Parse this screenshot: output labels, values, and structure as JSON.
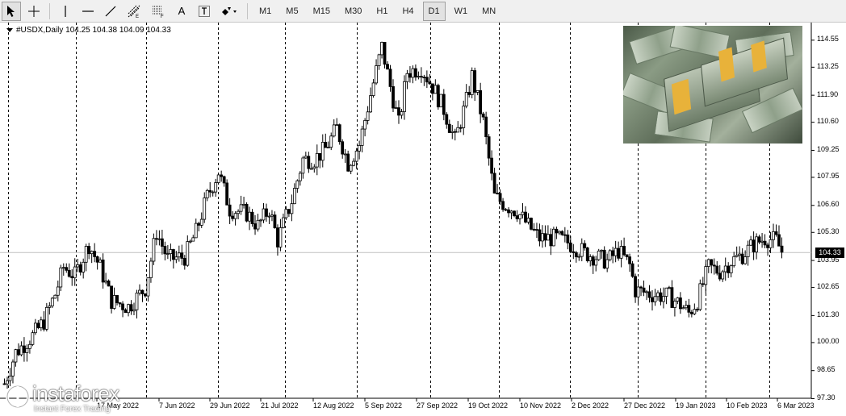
{
  "toolbar": {
    "tools": [
      {
        "name": "cursor",
        "icon": "arrow-cursor-icon"
      },
      {
        "name": "crosshair",
        "icon": "crosshair-icon"
      },
      {
        "name": "vertical-line",
        "icon": "vertical-line-icon"
      },
      {
        "name": "horizontal-line",
        "icon": "horizontal-line-icon"
      },
      {
        "name": "trend-line",
        "icon": "trend-line-icon"
      },
      {
        "name": "equidistant-channel",
        "icon": "channel-icon"
      },
      {
        "name": "fibonacci",
        "icon": "fibonacci-icon"
      },
      {
        "name": "text",
        "icon": "text-icon"
      },
      {
        "name": "text-label",
        "icon": "text-label-icon"
      },
      {
        "name": "shapes",
        "icon": "shapes-dropdown-icon"
      }
    ],
    "text_tool_glyph": "A",
    "timeframes": [
      "M1",
      "M5",
      "M15",
      "M30",
      "H1",
      "H4",
      "D1",
      "W1",
      "MN"
    ],
    "active_timeframe": "D1"
  },
  "chart": {
    "symbol_info": "#USDX,Daily  104.25 104.38 104.09 104.33",
    "price_levels": [
      "114.55",
      "113.25",
      "111.90",
      "110.60",
      "109.25",
      "107.95",
      "106.60",
      "105.30",
      "103.95",
      "102.65",
      "101.30",
      "100.00",
      "98.65",
      "97.30"
    ],
    "current_price": "104.33",
    "dates": [
      "17 May 2022",
      "7 Jun 2022",
      "29 Jun 2022",
      "21 Jul 2022",
      "12 Aug 2022",
      "5 Sep 2022",
      "27 Sep 2022",
      "19 Oct 2022",
      "10 Nov 2022",
      "2 Dec 2022",
      "27 Dec 2022",
      "19 Jan 2023",
      "10 Feb 2023",
      "6 Mar 2023"
    ],
    "colors": {
      "bull": "#ffffff",
      "bear": "#000000",
      "grid": "#000000",
      "price_line": "#c0c0c0"
    }
  },
  "logo": {
    "name": "instaforex",
    "tagline": "Instant Forex Trading"
  },
  "chart_data": {
    "type": "candlestick",
    "title": "#USDX,Daily",
    "ylim": [
      97.3,
      115.3
    ],
    "current": 104.33,
    "y_ticks": [
      114.55,
      113.25,
      111.9,
      110.6,
      109.25,
      107.95,
      106.6,
      105.3,
      103.95,
      102.65,
      101.3,
      100.0,
      98.65,
      97.3
    ],
    "anchors": [
      {
        "i": 0,
        "v": 98.0
      },
      {
        "i": 4,
        "v": 99.5
      },
      {
        "i": 10,
        "v": 100.3
      },
      {
        "i": 14,
        "v": 101.0
      },
      {
        "i": 18,
        "v": 102.3
      },
      {
        "i": 21,
        "v": 103.6
      },
      {
        "i": 25,
        "v": 103.2
      },
      {
        "i": 30,
        "v": 104.7
      },
      {
        "i": 34,
        "v": 103.6
      },
      {
        "i": 38,
        "v": 102.0
      },
      {
        "i": 44,
        "v": 101.7
      },
      {
        "i": 50,
        "v": 102.6
      },
      {
        "i": 54,
        "v": 105.3
      },
      {
        "i": 58,
        "v": 104.0
      },
      {
        "i": 64,
        "v": 104.1
      },
      {
        "i": 68,
        "v": 105.3
      },
      {
        "i": 72,
        "v": 107.0
      },
      {
        "i": 76,
        "v": 108.2
      },
      {
        "i": 80,
        "v": 106.4
      },
      {
        "i": 86,
        "v": 106.2
      },
      {
        "i": 90,
        "v": 105.6
      },
      {
        "i": 94,
        "v": 106.4
      },
      {
        "i": 97,
        "v": 104.9
      },
      {
        "i": 102,
        "v": 106.8
      },
      {
        "i": 106,
        "v": 108.8
      },
      {
        "i": 110,
        "v": 108.8
      },
      {
        "i": 114,
        "v": 109.3
      },
      {
        "i": 118,
        "v": 110.3
      },
      {
        "i": 122,
        "v": 108.6
      },
      {
        "i": 126,
        "v": 109.5
      },
      {
        "i": 130,
        "v": 111.9
      },
      {
        "i": 134,
        "v": 114.2
      },
      {
        "i": 137,
        "v": 112.3
      },
      {
        "i": 140,
        "v": 110.5
      },
      {
        "i": 143,
        "v": 113.0
      },
      {
        "i": 148,
        "v": 113.2
      },
      {
        "i": 152,
        "v": 112.3
      },
      {
        "i": 156,
        "v": 111.2
      },
      {
        "i": 160,
        "v": 109.7
      },
      {
        "i": 164,
        "v": 111.6
      },
      {
        "i": 166,
        "v": 112.8
      },
      {
        "i": 170,
        "v": 110.6
      },
      {
        "i": 174,
        "v": 107.0
      },
      {
        "i": 178,
        "v": 106.6
      },
      {
        "i": 182,
        "v": 106.3
      },
      {
        "i": 186,
        "v": 105.6
      },
      {
        "i": 190,
        "v": 105.0
      },
      {
        "i": 196,
        "v": 105.0
      },
      {
        "i": 200,
        "v": 104.8
      },
      {
        "i": 206,
        "v": 104.3
      },
      {
        "i": 210,
        "v": 104.1
      },
      {
        "i": 214,
        "v": 103.9
      },
      {
        "i": 218,
        "v": 104.4
      },
      {
        "i": 222,
        "v": 103.7
      },
      {
        "i": 224,
        "v": 102.5
      },
      {
        "i": 230,
        "v": 102.3
      },
      {
        "i": 236,
        "v": 102.2
      },
      {
        "i": 240,
        "v": 101.8
      },
      {
        "i": 243,
        "v": 101.4
      },
      {
        "i": 246,
        "v": 102.0
      },
      {
        "i": 250,
        "v": 103.6
      },
      {
        "i": 254,
        "v": 103.4
      },
      {
        "i": 258,
        "v": 103.9
      },
      {
        "i": 262,
        "v": 104.2
      },
      {
        "i": 266,
        "v": 104.7
      },
      {
        "i": 270,
        "v": 105.0
      },
      {
        "i": 274,
        "v": 104.9
      },
      {
        "i": 276,
        "v": 104.33
      }
    ]
  }
}
